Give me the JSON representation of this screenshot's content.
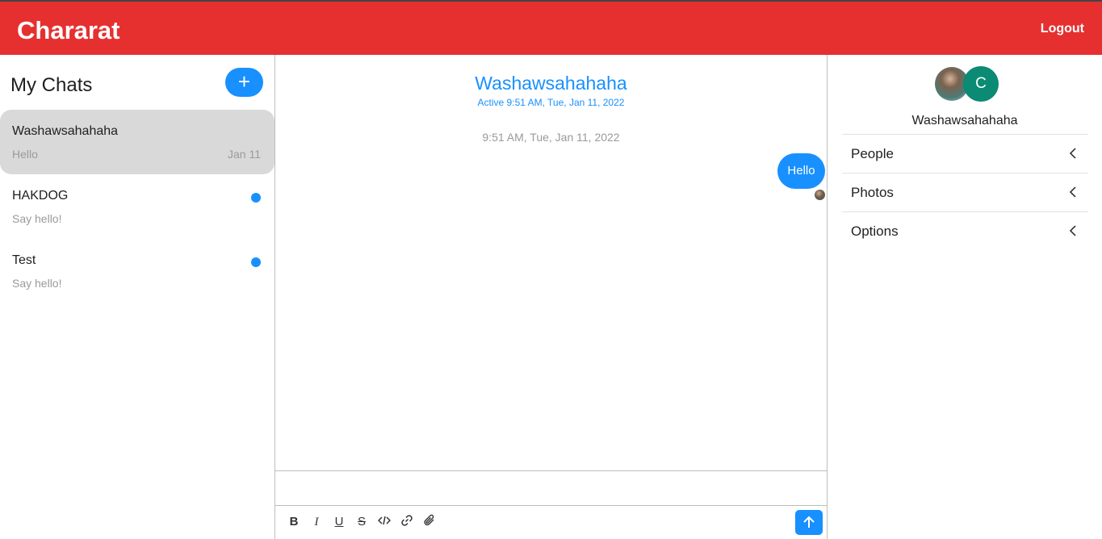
{
  "header": {
    "brand": "Chararat",
    "logout": "Logout"
  },
  "sidebar": {
    "title": "My Chats",
    "new_chat_label": "+",
    "chats": [
      {
        "name": "Washawsahahaha",
        "last_message": "Hello",
        "date": "Jan 11",
        "active": true,
        "unread": false
      },
      {
        "name": "HAKDOG",
        "last_message": "Say hello!",
        "date": "",
        "active": false,
        "unread": true
      },
      {
        "name": "Test",
        "last_message": "Say hello!",
        "date": "",
        "active": false,
        "unread": true
      }
    ]
  },
  "chat": {
    "title": "Washawsahahaha",
    "status": "Active 9:51 AM, Tue, Jan 11, 2022",
    "messages": [
      {
        "timestamp": "9:51 AM, Tue, Jan 11, 2022",
        "text": "Hello",
        "sender": "me"
      }
    ]
  },
  "composer": {
    "placeholder": "",
    "tools": [
      "bold-icon",
      "italic-icon",
      "underline-icon",
      "strikethrough-icon",
      "code-icon",
      "link-icon",
      "attachment-icon"
    ]
  },
  "details": {
    "avatar_initial": "C",
    "name": "Washawsahahaha",
    "sections": [
      "People",
      "Photos",
      "Options"
    ]
  },
  "colors": {
    "header": "#e63030",
    "accent": "#1890ff",
    "avatar": "#0b8a74",
    "active_chat": "#d9d9d9"
  }
}
